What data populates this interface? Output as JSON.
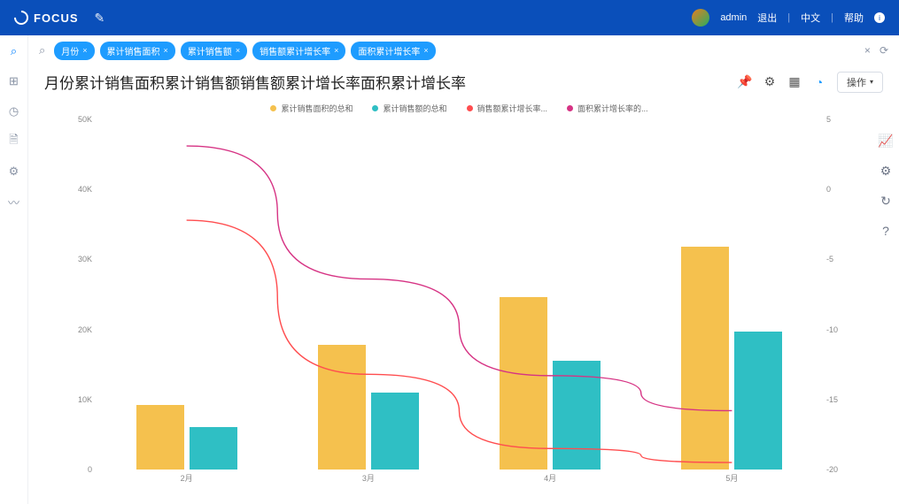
{
  "header": {
    "brand": "FOCUS",
    "user": "admin",
    "logout": "退出",
    "lang": "中文",
    "help": "帮助"
  },
  "query": {
    "chips": [
      "月份",
      "累计销售面积",
      "累计销售额",
      "销售额累计增长率",
      "面积累计增长率"
    ]
  },
  "title": "月份累计销售面积累计销售额销售额累计增长率面积累计增长率",
  "ops_label": "操作",
  "legend": {
    "s1": "累计销售面积的总和",
    "s2": "累计销售额的总和",
    "s3": "销售额累计增长率...",
    "s4": "面积累计增长率的..."
  },
  "chart_data": {
    "type": "bar",
    "categories": [
      "2月",
      "3月",
      "4月",
      "5月"
    ],
    "y_left_ticks": [
      0,
      "10K",
      "20K",
      "30K",
      "40K",
      "50K"
    ],
    "y_right_ticks": [
      5,
      0,
      -5,
      -10,
      -15,
      -20
    ],
    "y_left_range": [
      0,
      50000
    ],
    "y_right_range": [
      -20,
      5
    ],
    "series": [
      {
        "name": "累计销售面积的总和",
        "type": "bar",
        "color": "#f5c14e",
        "values": [
          9200,
          17800,
          24600,
          31800
        ]
      },
      {
        "name": "累计销售额的总和",
        "type": "bar",
        "color": "#2fbfc4",
        "values": [
          6100,
          11000,
          15500,
          19700
        ]
      },
      {
        "name": "销售额累计增长率",
        "type": "line",
        "color": "#ff4d4f",
        "values": [
          -2.2,
          -13.2,
          -18.5,
          -19.5
        ]
      },
      {
        "name": "面积累计增长率",
        "type": "line",
        "color": "#d63384",
        "values": [
          3.1,
          -6.4,
          -13.3,
          -15.8
        ]
      }
    ]
  }
}
